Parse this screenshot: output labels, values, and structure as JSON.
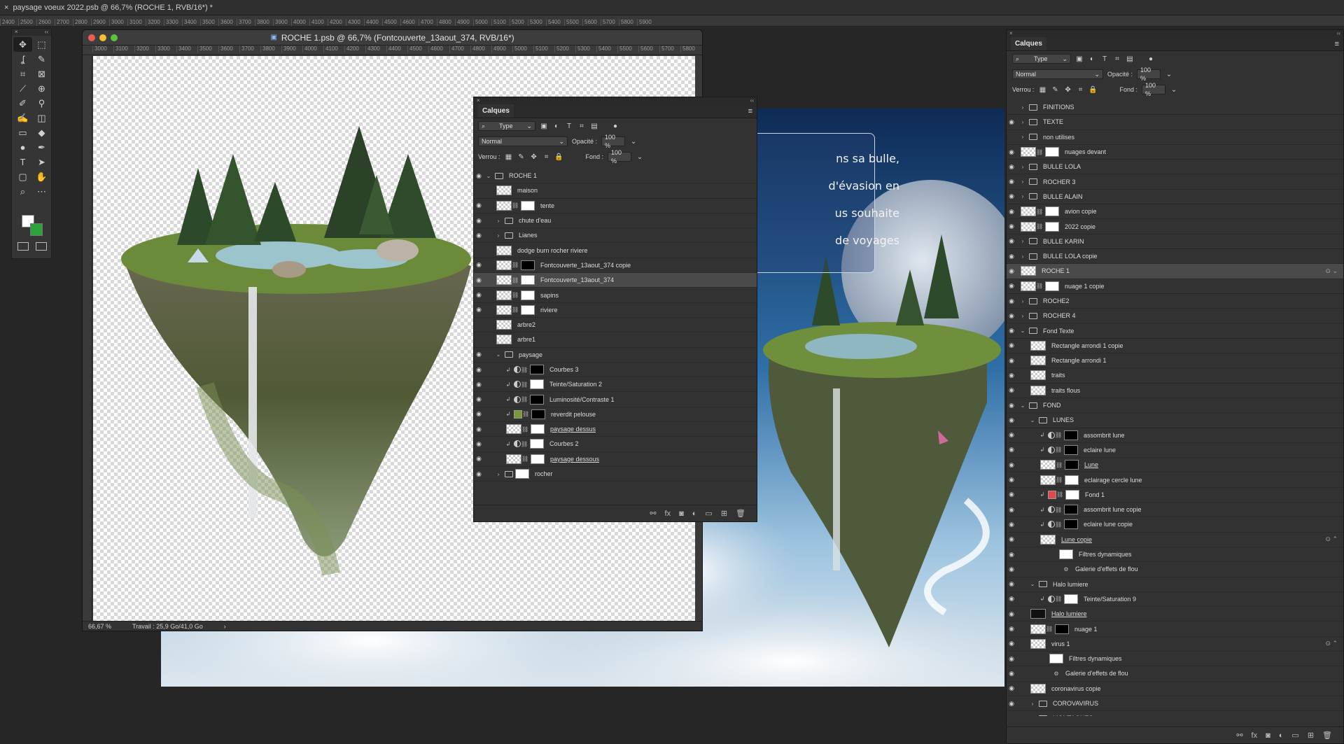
{
  "doc_tab": {
    "close": "×",
    "title": "paysage voeux 2022.psb @ 66,7% (ROCHE 1, RVB/16*) *"
  },
  "top_ruler": [
    "2400",
    "2500",
    "2600",
    "2700",
    "2800",
    "2900",
    "3000",
    "3100",
    "3200",
    "3300",
    "3400",
    "3500",
    "3600",
    "3700",
    "3800",
    "3900",
    "4000",
    "4100",
    "4200",
    "4300",
    "4400",
    "4500",
    "4600",
    "4700",
    "4800",
    "4900",
    "5000",
    "5100",
    "5200",
    "5300",
    "5400",
    "5500",
    "5600",
    "5700",
    "5800",
    "5900"
  ],
  "toolbar": {
    "tools": [
      "move-tool",
      "marquee-tool",
      "lasso-tool",
      "quick-select-tool",
      "crop-tool",
      "frame-tool",
      "eyedropper-tool",
      "healing-tool",
      "brush-tool",
      "stamp-tool",
      "history-brush-tool",
      "eraser-tool",
      "gradient-tool",
      "blur-tool",
      "dodge-tool",
      "pen-tool",
      "type-tool",
      "path-select-tool",
      "rectangle-tool",
      "hand-tool",
      "zoom-tool",
      "more-tools"
    ],
    "glyphs": [
      "✥",
      "⬚",
      "ʆ",
      "✎",
      "⌗",
      "⊠",
      "⟋",
      "⊕",
      "✐",
      "⚲",
      "✍",
      "◫",
      "▭",
      "◆",
      "●",
      "✒",
      "T",
      "➤",
      "▢",
      "✋",
      "⌕",
      "⋯"
    ],
    "fg_color": "#ffffff",
    "bg_color": "#2ca23a"
  },
  "roche_window": {
    "title": "ROCHE 1.psb @ 66,7% (Fontcouverte_13aout_374, RVB/16*)",
    "ruler": [
      "3000",
      "3100",
      "3200",
      "3300",
      "3400",
      "3500",
      "3600",
      "3700",
      "3800",
      "3900",
      "4000",
      "4100",
      "4200",
      "4300",
      "4400",
      "4500",
      "4600",
      "4700",
      "4800",
      "4900",
      "5000",
      "5100",
      "5200",
      "5300",
      "5400",
      "5500",
      "5600",
      "5700",
      "5800"
    ],
    "zoom": "66,67 %",
    "status": "Travail : 25,9 Go/41,0 Go",
    "status_arrow": "›"
  },
  "bg_text": [
    "ns sa bulle,",
    "d'évasion en",
    "us souhaite",
    "de voyages"
  ],
  "float_panel": {
    "tab": "Calques",
    "menu": "≡",
    "filter": "Type",
    "blend": "Normal",
    "opacity_label": "Opacité :",
    "opacity": "100 %",
    "lock_label": "Verrou :",
    "fill_label": "Fond :",
    "fill": "100 %",
    "layers": [
      {
        "name": "ROCHE 1",
        "type": "group-open",
        "eye": true,
        "indent": 0
      },
      {
        "name": "maison",
        "type": "smart",
        "eye": false,
        "indent": 1
      },
      {
        "name": "tente",
        "type": "smart-mask",
        "eye": true,
        "indent": 1
      },
      {
        "name": "chute d'eau",
        "type": "group",
        "eye": true,
        "indent": 1
      },
      {
        "name": "Lianes",
        "type": "group",
        "eye": true,
        "indent": 1
      },
      {
        "name": "dodge burn rocher riviere",
        "type": "pixel",
        "eye": false,
        "indent": 1
      },
      {
        "name": "Fontcouverte_13aout_374 copie",
        "type": "smart-mask-black",
        "eye": true,
        "indent": 1
      },
      {
        "name": "Fontcouverte_13aout_374",
        "type": "smart-mask",
        "eye": true,
        "indent": 1,
        "selected": true
      },
      {
        "name": "sapins",
        "type": "smart-mask",
        "eye": true,
        "indent": 1
      },
      {
        "name": "riviere",
        "type": "smart-mask",
        "eye": true,
        "indent": 1
      },
      {
        "name": "arbre2",
        "type": "smart",
        "eye": false,
        "indent": 1
      },
      {
        "name": "arbre1",
        "type": "smart",
        "eye": false,
        "indent": 1
      },
      {
        "name": "paysage",
        "type": "group-open",
        "eye": true,
        "indent": 1
      },
      {
        "name": "Courbes 3",
        "type": "adj-black",
        "eye": true,
        "indent": 2
      },
      {
        "name": "Teinte/Saturation 2",
        "type": "adj",
        "eye": true,
        "indent": 2
      },
      {
        "name": "Luminosité/Contraste 1",
        "type": "adj-black",
        "eye": true,
        "indent": 2
      },
      {
        "name": "reverdit pelouse",
        "type": "color-mask",
        "eye": true,
        "indent": 2
      },
      {
        "name": "paysage dessus",
        "type": "smart-mask",
        "eye": true,
        "indent": 2,
        "underline": true
      },
      {
        "name": "Courbes 2",
        "type": "adj",
        "eye": true,
        "indent": 2
      },
      {
        "name": "paysage dessous",
        "type": "smart-mask",
        "eye": true,
        "indent": 2,
        "underline": true
      },
      {
        "name": "rocher",
        "type": "group-mask",
        "eye": true,
        "indent": 1
      }
    ],
    "footer": [
      "⚯",
      "fx",
      "◙",
      "◐",
      "▭",
      "⊞",
      "🗑"
    ]
  },
  "right_panel": {
    "tab": "Calques",
    "menu": "≡",
    "filter": "Type",
    "blend": "Normal",
    "opacity_label": "Opacité :",
    "opacity": "100 %",
    "lock_label": "Verrou :",
    "fill_label": "Fond :",
    "fill": "100 %",
    "layers": [
      {
        "name": "FINITIONS",
        "type": "group",
        "eye": false,
        "indent": 0
      },
      {
        "name": "TEXTE",
        "type": "group",
        "eye": true,
        "indent": 0
      },
      {
        "name": "non utilises",
        "type": "group",
        "eye": false,
        "indent": 0
      },
      {
        "name": "nuages devant",
        "type": "pixel-mask",
        "eye": true,
        "indent": 0
      },
      {
        "name": "BULLE LOLA",
        "type": "group",
        "eye": true,
        "indent": 0
      },
      {
        "name": "ROCHER 3",
        "type": "group",
        "eye": true,
        "indent": 0
      },
      {
        "name": "BULLE  ALAIN",
        "type": "group",
        "eye": true,
        "indent": 0
      },
      {
        "name": "avion copie",
        "type": "smart-mask",
        "eye": true,
        "indent": 0
      },
      {
        "name": "2022 copie",
        "type": "pixel-mask",
        "eye": true,
        "indent": 0
      },
      {
        "name": "BULLE KARIN",
        "type": "group",
        "eye": true,
        "indent": 0
      },
      {
        "name": "BULLE LOLA copie",
        "type": "group",
        "eye": true,
        "indent": 0
      },
      {
        "name": "ROCHE 1",
        "type": "smart",
        "eye": true,
        "indent": 0,
        "selected": true,
        "right": "⊙ ⌄"
      },
      {
        "name": "nuage 1 copie",
        "type": "pixel-mask",
        "eye": true,
        "indent": 0
      },
      {
        "name": "ROCHE2",
        "type": "group",
        "eye": true,
        "indent": 0
      },
      {
        "name": "ROCHER 4",
        "type": "group",
        "eye": true,
        "indent": 0
      },
      {
        "name": "Fond Texte",
        "type": "group-open",
        "eye": true,
        "indent": 0
      },
      {
        "name": "Rectangle arrondi 1 copie",
        "type": "shape",
        "eye": true,
        "indent": 1
      },
      {
        "name": "Rectangle arrondi 1",
        "type": "shape",
        "eye": true,
        "indent": 1
      },
      {
        "name": "traits",
        "type": "shape",
        "eye": true,
        "indent": 1
      },
      {
        "name": "traits flous",
        "type": "pixel",
        "eye": true,
        "indent": 1
      },
      {
        "name": "FOND",
        "type": "group-open",
        "eye": true,
        "indent": 0
      },
      {
        "name": "LUNES",
        "type": "group-open",
        "eye": true,
        "indent": 1
      },
      {
        "name": "assombrit lune",
        "type": "adj-black",
        "eye": true,
        "indent": 2
      },
      {
        "name": "eclaire lune",
        "type": "adj-black",
        "eye": true,
        "indent": 2
      },
      {
        "name": "Lune",
        "type": "pixel-mask-black",
        "eye": true,
        "indent": 2,
        "underline": true
      },
      {
        "name": "eclairage cercle lune",
        "type": "pixel-mask",
        "eye": true,
        "indent": 2
      },
      {
        "name": "Fond 1",
        "type": "color-red",
        "eye": true,
        "indent": 2
      },
      {
        "name": "assombrit lune copie",
        "type": "adj-black",
        "eye": true,
        "indent": 2
      },
      {
        "name": "eclaire lune copie",
        "type": "adj-black",
        "eye": true,
        "indent": 2
      },
      {
        "name": "Lune copie",
        "type": "smart",
        "eye": true,
        "indent": 2,
        "underline": true,
        "right": "⊙ ⌃"
      },
      {
        "name": "Filtres dynamiques",
        "type": "filter",
        "eye": true,
        "indent": 3
      },
      {
        "name": "Galerie d'effets de flou",
        "type": "filter-item",
        "eye": true,
        "indent": 3
      },
      {
        "name": "Halo lumiere",
        "type": "group-open",
        "eye": true,
        "indent": 1
      },
      {
        "name": "Teinte/Saturation 9",
        "type": "adj",
        "eye": true,
        "indent": 2
      },
      {
        "name": "Halo lumiere",
        "type": "pixel-black",
        "eye": true,
        "indent": 1,
        "underline": true
      },
      {
        "name": "nuage 1",
        "type": "pixel-mask-black",
        "eye": true,
        "indent": 1
      },
      {
        "name": "virus 1",
        "type": "smart",
        "eye": true,
        "indent": 1,
        "right": "⊙ ⌃"
      },
      {
        "name": "Filtres dynamiques",
        "type": "filter",
        "eye": true,
        "indent": 2
      },
      {
        "name": "Galerie d'effets de flou",
        "type": "filter-item",
        "eye": true,
        "indent": 2
      },
      {
        "name": "coronavirus copie",
        "type": "smart",
        "eye": true,
        "indent": 1
      },
      {
        "name": "COROVAVIRUS",
        "type": "group",
        "eye": true,
        "indent": 1
      },
      {
        "name": "MONTAGNES",
        "type": "group",
        "eye": true,
        "indent": 1
      }
    ],
    "footer": [
      "⚯",
      "fx",
      "◙",
      "◐",
      "▭",
      "⊞",
      "🗑"
    ]
  }
}
